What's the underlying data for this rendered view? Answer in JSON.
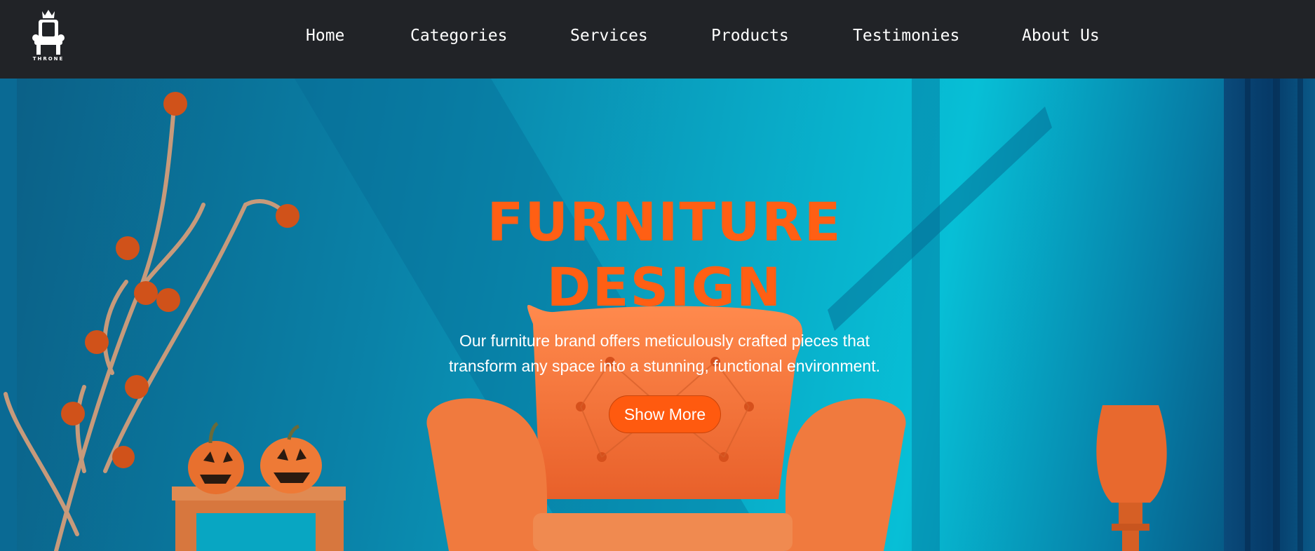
{
  "brand": {
    "name": "THRONE",
    "logo_icon": "throne-chair-icon"
  },
  "nav": {
    "items": [
      {
        "label": "Home"
      },
      {
        "label": "Categories"
      },
      {
        "label": "Services"
      },
      {
        "label": "Products"
      },
      {
        "label": "Testimonies"
      },
      {
        "label": "About Us"
      }
    ]
  },
  "hero": {
    "title_line1": "FURNITURE",
    "title_line2": "DESIGN",
    "description_line1": "Our furniture brand offers meticulously crafted pieces that",
    "description_line2": "transform any space into a stunning, functional environment.",
    "cta_label": "Show More"
  },
  "colors": {
    "navbar_bg": "#212327",
    "accent": "#ff5f14",
    "hero_bg": "#09a9c6",
    "text_light": "#ffffff"
  }
}
